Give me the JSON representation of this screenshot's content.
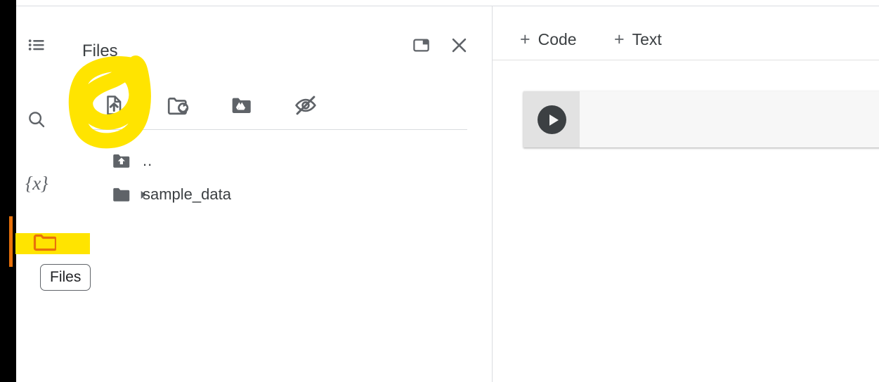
{
  "window": {
    "background_color": "#000000",
    "surface_color": "#ffffff"
  },
  "icon_rail": {
    "items": [
      {
        "name": "search",
        "icon": "search-icon",
        "label": "Search",
        "active": false
      },
      {
        "name": "variables",
        "icon": "variables-icon",
        "label": "{x}",
        "glyph": "{x}",
        "active": false
      },
      {
        "name": "files",
        "icon": "folder-icon",
        "label": "Files",
        "active": true,
        "indicator_color": "#e8710a"
      }
    ]
  },
  "files_panel": {
    "title": "Files",
    "menu_icon": "list-icon",
    "header_buttons": [
      {
        "name": "toggle-panel",
        "icon": "panel-layout-icon",
        "label": "Toggle panel"
      },
      {
        "name": "close-panel",
        "icon": "close-icon",
        "label": "Close"
      }
    ],
    "toolbar": [
      {
        "name": "upload-to-session-storage",
        "icon": "upload-file-icon",
        "label": "Upload to session storage",
        "highlighted": true
      },
      {
        "name": "refresh",
        "icon": "folder-refresh-icon",
        "label": "Refresh"
      },
      {
        "name": "mount-drive",
        "icon": "google-drive-folder-icon",
        "label": "Mount Drive"
      },
      {
        "name": "toggle-hidden",
        "icon": "eye-off-icon",
        "label": "Show/hide hidden files"
      }
    ],
    "tree": [
      {
        "name": "parent-directory",
        "label": "..",
        "icon": "folder-up-icon",
        "has_caret": false
      },
      {
        "name": "sample_data",
        "label": "sample_data",
        "icon": "folder-icon",
        "has_caret": true,
        "expanded": false
      }
    ]
  },
  "notebook": {
    "toolbar": [
      {
        "name": "add-code-cell",
        "plus": "+",
        "label": "Code"
      },
      {
        "name": "add-text-cell",
        "plus": "+",
        "label": "Text"
      }
    ],
    "cell": {
      "name": "code-cell",
      "run_button_label": "Run cell",
      "run_icon": "play-icon",
      "content": ""
    }
  },
  "tooltip": {
    "label": "Files"
  },
  "annotations": {
    "highlight_color": "#ffe400",
    "accent_color": "#e8710a",
    "circle_target": "upload-to-session-storage",
    "bar_target": "files-rail-item"
  }
}
